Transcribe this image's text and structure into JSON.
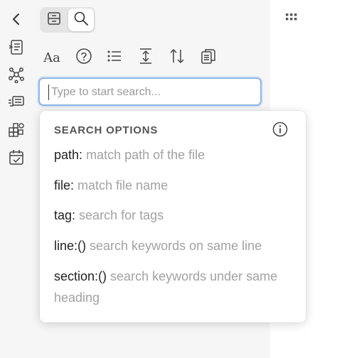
{
  "ribbon": {
    "icons": [
      "collapse-chevron-icon",
      "file-explorer-icon",
      "graph-view-icon",
      "slides-icon",
      "canvas-icon",
      "daily-note-icon"
    ]
  },
  "tabs": [
    {
      "name": "bookmarks-tab",
      "icon": "bookmark-box-icon",
      "active": false
    },
    {
      "name": "search-tab",
      "icon": "search-icon",
      "active": true
    }
  ],
  "toolbar": {
    "case_label": "Aa",
    "icons": [
      "match-case-icon",
      "help-icon",
      "list-icon",
      "expand-collapse-icon",
      "sort-icon",
      "copy-results-icon"
    ]
  },
  "search": {
    "placeholder": "Type to start search...",
    "value": ""
  },
  "options": {
    "title": "SEARCH OPTIONS",
    "items": [
      {
        "key": "path:",
        "desc": "match path of the file"
      },
      {
        "key": "file:",
        "desc": "match file name"
      },
      {
        "key": "tag:",
        "desc": "search for tags"
      },
      {
        "key": "line:()",
        "desc": "search keywords on same line"
      },
      {
        "key": "section:()",
        "desc": "search keywords under same heading"
      }
    ]
  },
  "colors": {
    "sidebar_bg": "#f6f6f6",
    "focus_ring": "#8fb7e8",
    "muted_text": "#a2a2a2"
  }
}
